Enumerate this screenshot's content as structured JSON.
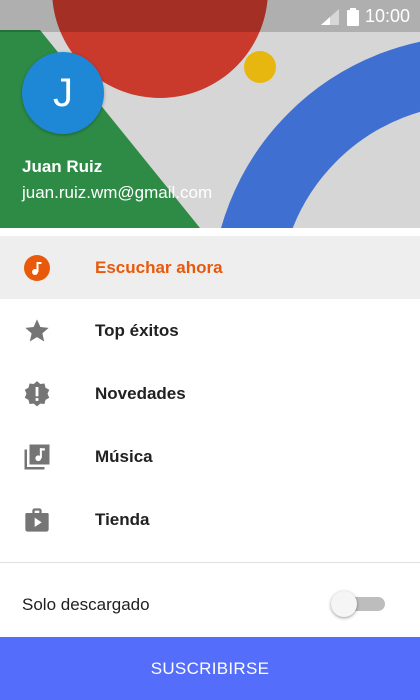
{
  "status_bar": {
    "time": "10:00"
  },
  "account": {
    "avatar_letter": "J",
    "name": "Juan Ruiz",
    "email": "juan.ruiz.wm@gmail.com"
  },
  "menu": {
    "items": [
      {
        "label": "Escuchar ahora",
        "icon": "listen-now-icon",
        "active": true
      },
      {
        "label": "Top éxitos",
        "icon": "star-icon",
        "active": false
      },
      {
        "label": "Novedades",
        "icon": "new-release-icon",
        "active": false
      },
      {
        "label": "Música",
        "icon": "music-library-icon",
        "active": false
      },
      {
        "label": "Tienda",
        "icon": "shop-icon",
        "active": false
      }
    ]
  },
  "offline": {
    "label": "Solo descargado",
    "enabled": false
  },
  "subscribe": {
    "label": "SUSCRIBIRSE"
  },
  "colors": {
    "accent": "#e8590c",
    "subscribe_bg": "#546dfb",
    "avatar_bg": "#1e88d6"
  }
}
